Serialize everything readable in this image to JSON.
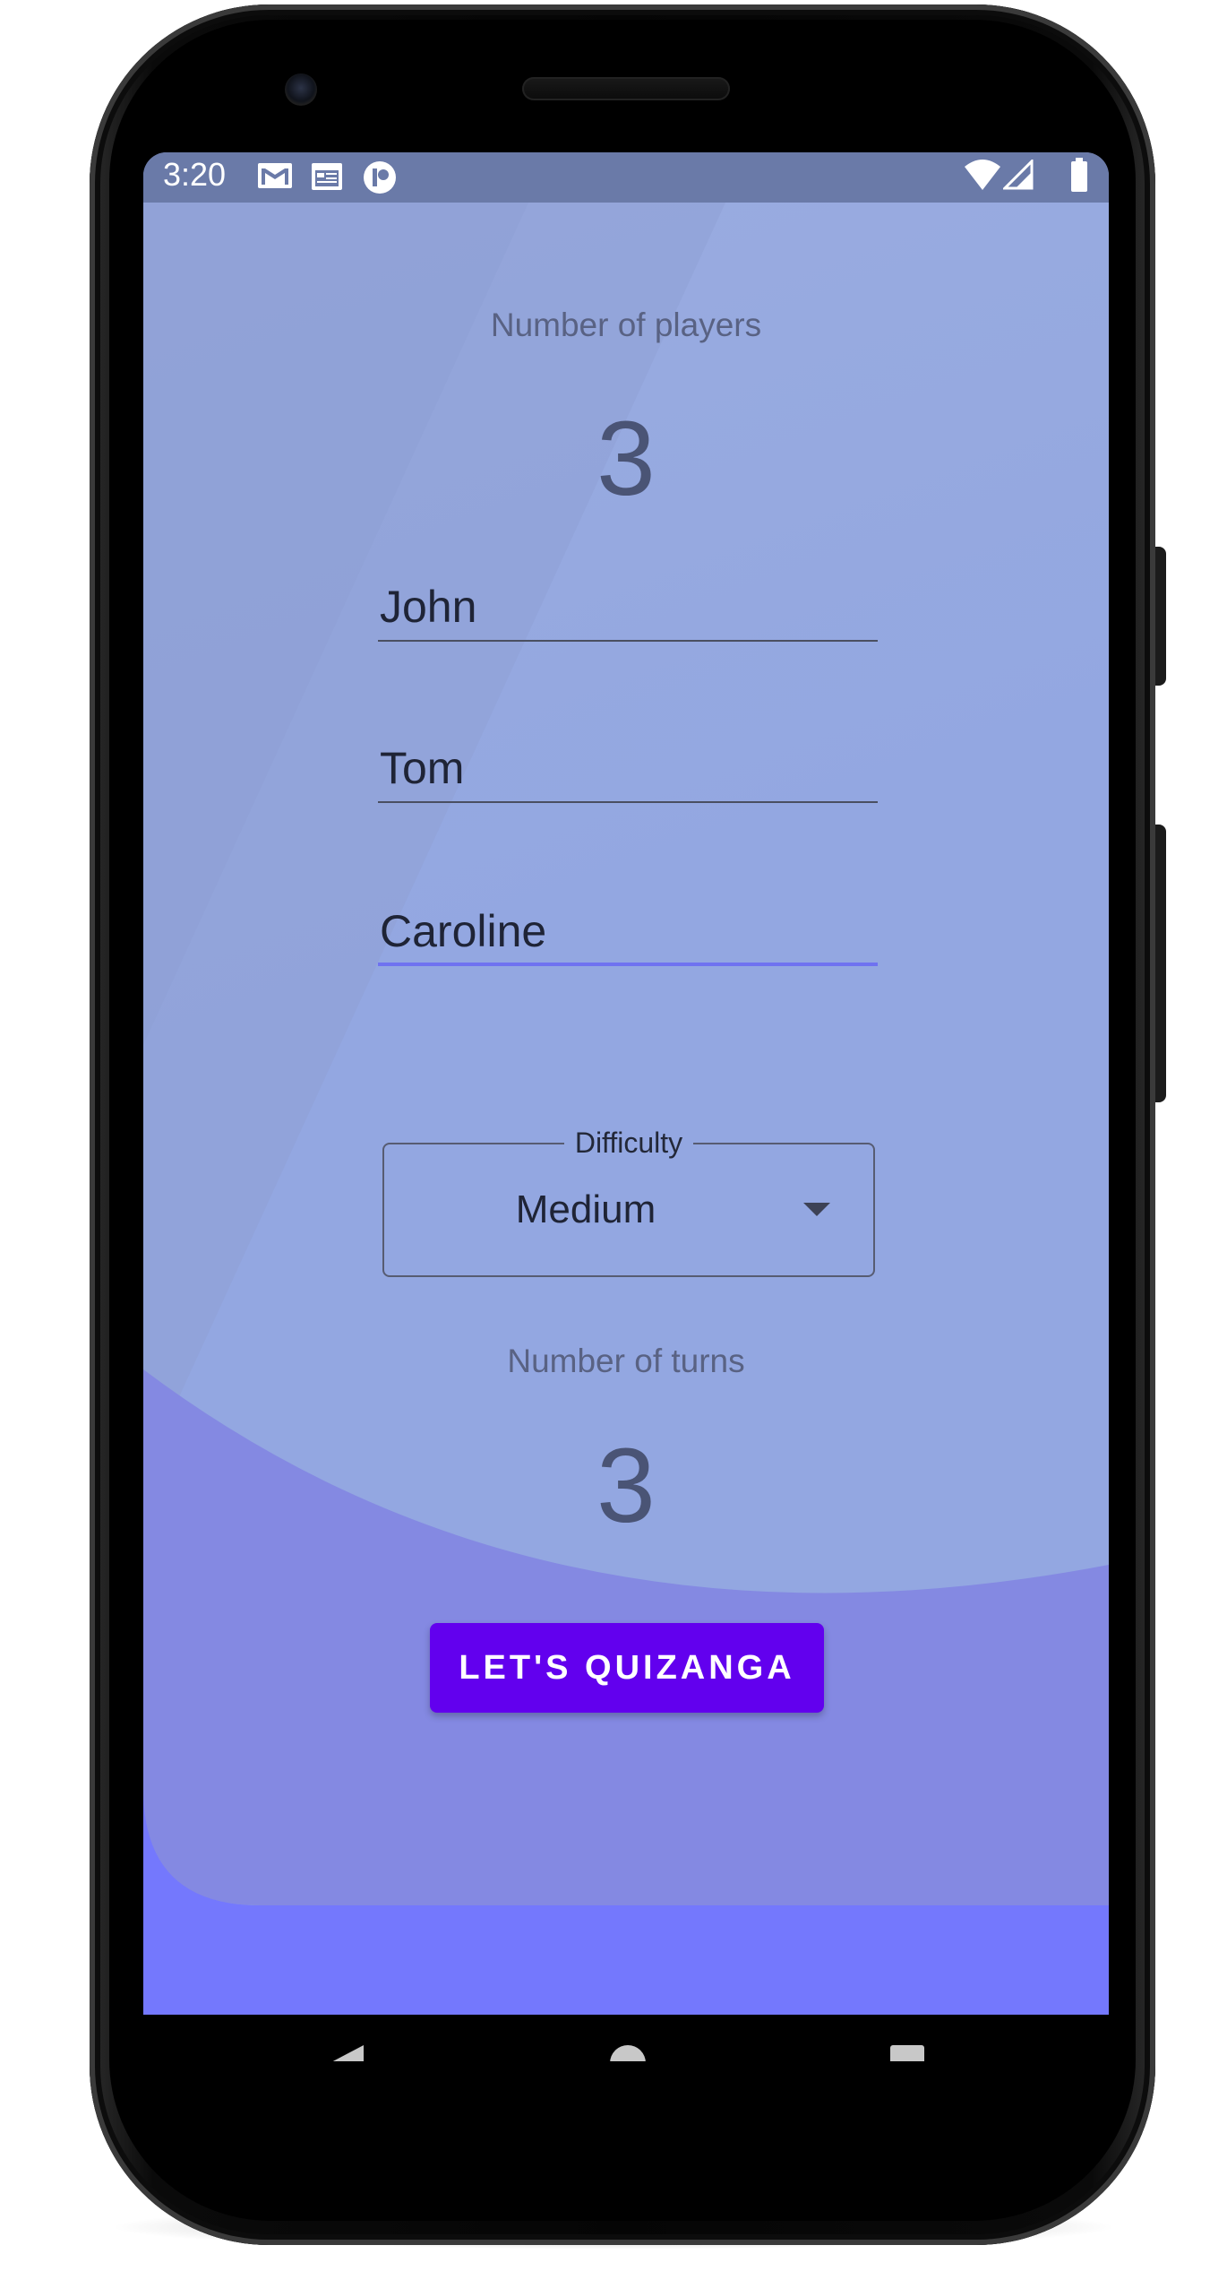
{
  "status_bar": {
    "time": "3:20",
    "icons": [
      "gmail-icon",
      "calendar-icon",
      "app-notification-icon",
      "wifi-icon",
      "cell-signal-icon",
      "battery-icon"
    ]
  },
  "players": {
    "label": "Number of players",
    "count": "3",
    "names": [
      "John",
      "Tom",
      "Caroline"
    ]
  },
  "difficulty": {
    "label": "Difficulty",
    "selected": "Medium"
  },
  "turns": {
    "label": "Number of turns",
    "count": "3"
  },
  "action": {
    "label": "LET'S QUIZANGA"
  },
  "nav": {
    "buttons": [
      "back-icon",
      "home-icon",
      "recents-icon"
    ]
  },
  "colors": {
    "background": "#93a7e1",
    "wave": "#8489e2",
    "bottom_band": "#7478fd",
    "button": "#6200ee",
    "focused_underline": "#6f72f0",
    "status_bar": "#6a7aa8"
  }
}
